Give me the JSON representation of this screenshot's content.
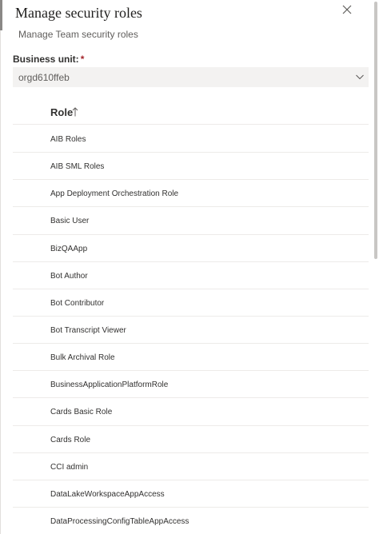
{
  "panel": {
    "title": "Manage security roles",
    "subtitle": "Manage Team security roles",
    "close_icon": "close-icon"
  },
  "business_unit": {
    "label": "Business unit:",
    "required_marker": "*",
    "value": "orgd610ffeb",
    "icon": "chevron-down-icon"
  },
  "roles_table": {
    "column_header": "Role",
    "sort_icon": "sort-ascending-arrow-icon",
    "rows": [
      {
        "name": "AIB Roles"
      },
      {
        "name": "AIB SML Roles"
      },
      {
        "name": "App Deployment Orchestration Role"
      },
      {
        "name": "Basic User"
      },
      {
        "name": "BizQAApp"
      },
      {
        "name": "Bot Author"
      },
      {
        "name": "Bot Contributor"
      },
      {
        "name": "Bot Transcript Viewer"
      },
      {
        "name": "Bulk Archival Role"
      },
      {
        "name": "BusinessApplicationPlatformRole"
      },
      {
        "name": "Cards Basic Role"
      },
      {
        "name": "Cards Role"
      },
      {
        "name": "CCI admin"
      },
      {
        "name": "DataLakeWorkspaceAppAccess"
      },
      {
        "name": "DataProcessingConfigTableAppAccess"
      }
    ]
  },
  "colors": {
    "required": "#a4262c",
    "select_bg": "#f3f2f1",
    "divider": "#edebe9"
  }
}
